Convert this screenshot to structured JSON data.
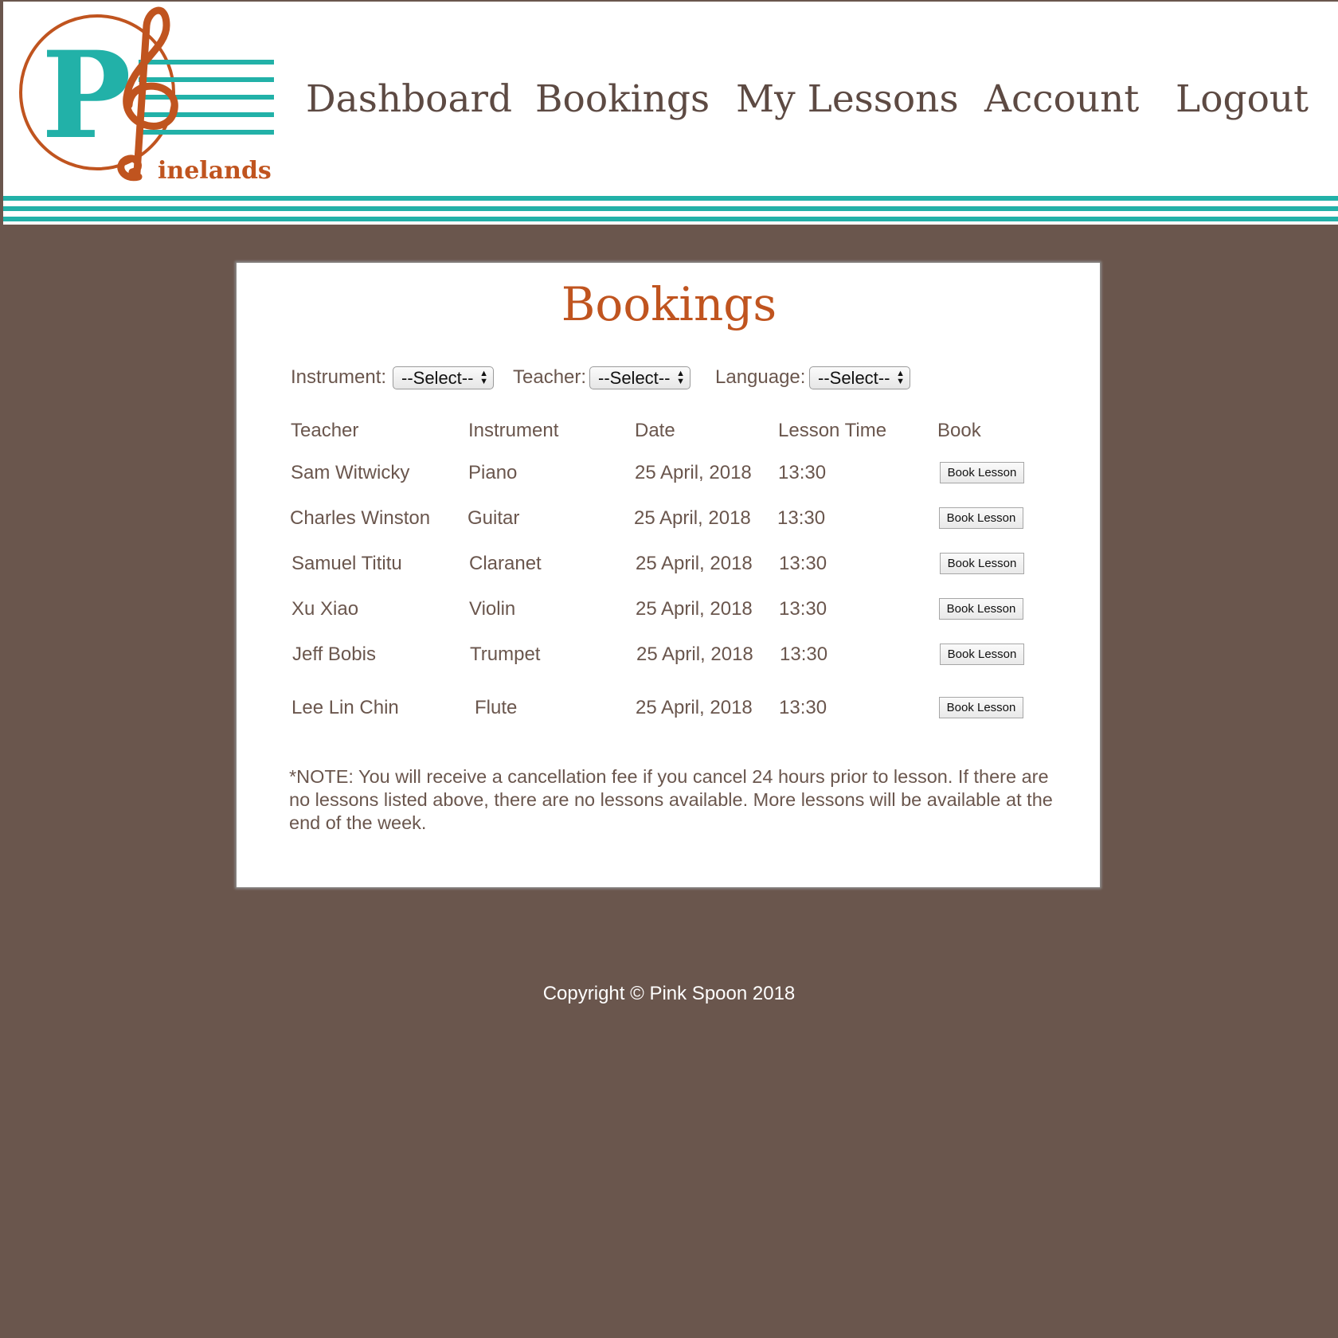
{
  "site": {
    "logo_text": "inelands",
    "logo_letter": "P"
  },
  "nav": {
    "items": [
      {
        "label": "Dashboard"
      },
      {
        "label": "Bookings"
      },
      {
        "label": "My Lessons"
      },
      {
        "label": "Account"
      },
      {
        "label": "Logout"
      }
    ]
  },
  "page": {
    "title": "Bookings"
  },
  "filters": {
    "instrument": {
      "label": "Instrument:",
      "selected": "--Select--"
    },
    "teacher": {
      "label": "Teacher:",
      "selected": "--Select--"
    },
    "language": {
      "label": "Language:",
      "selected": "--Select--"
    }
  },
  "table": {
    "headers": [
      "Teacher",
      "Instrument",
      "Date",
      "Lesson Time",
      "Book"
    ],
    "rows": [
      {
        "teacher": "Sam Witwicky",
        "instrument": "Piano",
        "date": "25 April, 2018",
        "time": "13:30",
        "button": "Book Lesson"
      },
      {
        "teacher": "Charles Winston",
        "instrument": "Guitar",
        "date": "25 April, 2018",
        "time": "13:30",
        "button": "Book Lesson"
      },
      {
        "teacher": "Samuel Tititu",
        "instrument": "Claranet",
        "date": "25 April, 2018",
        "time": "13:30",
        "button": "Book Lesson"
      },
      {
        "teacher": "Xu Xiao",
        "instrument": "Violin",
        "date": "25 April, 2018",
        "time": "13:30",
        "button": "Book Lesson"
      },
      {
        "teacher": "Jeff Bobis",
        "instrument": "Trumpet",
        "date": "25 April, 2018",
        "time": "13:30",
        "button": "Book Lesson"
      },
      {
        "teacher": "Lee Lin Chin",
        "instrument": "Flute",
        "date": "25 April, 2018",
        "time": "13:30",
        "button": "Book Lesson"
      }
    ]
  },
  "note": "*NOTE: You will receive a cancellation fee if you cancel 24 hours prior to lesson. If there are no lessons listed above, there are no lessons available. More lessons will be available at the end of the week.",
  "footer": {
    "copyright": "Copyright © Pink Spoon 2018"
  },
  "colors": {
    "background": "#6a564d",
    "accent_teal": "#22b1a8",
    "accent_orange": "#c0541f",
    "text_brown": "#5d4a43"
  }
}
